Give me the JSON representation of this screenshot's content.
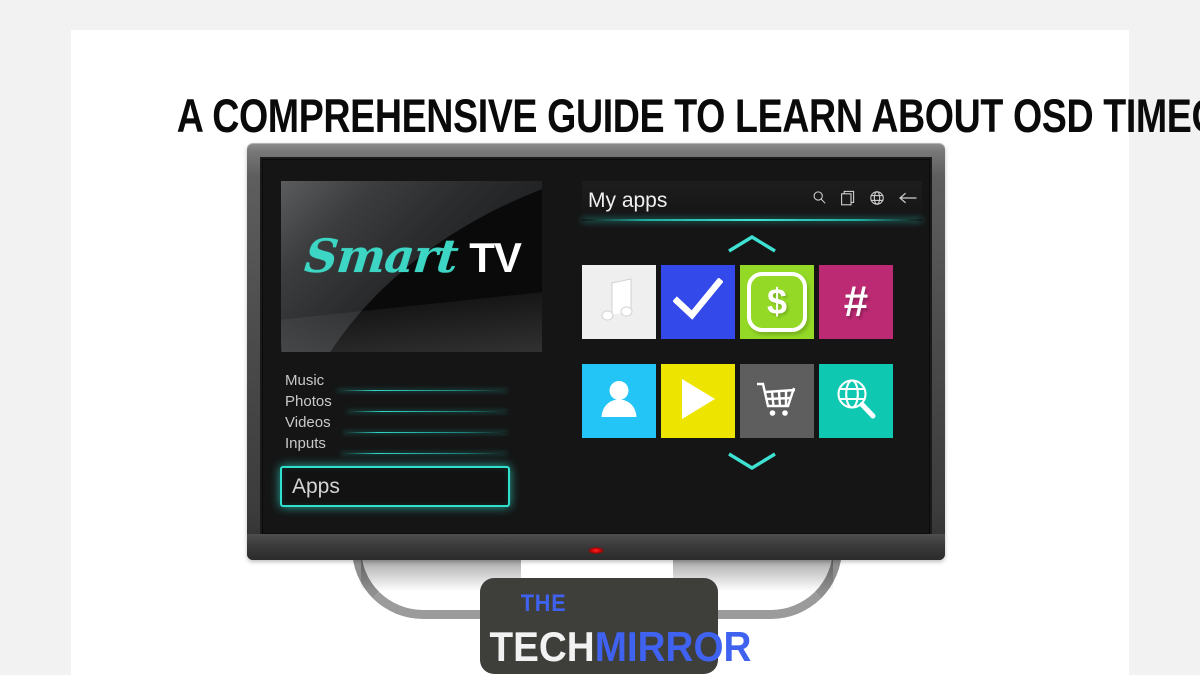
{
  "page": {
    "background_color": "#f2f2f2",
    "panel_color": "#ffffff",
    "title": "A COMPREHENSIVE GUIDE TO LEARN ABOUT OSD TIMEOUT"
  },
  "tv": {
    "brand_panel": {
      "script_word": "Smart",
      "block_word": "TV",
      "script_color": "#3dd6c4",
      "block_color": "#ffffff"
    },
    "led_color": "#ff2b2b",
    "bezel_color": "#4a4a4a",
    "screen_color": "#151515",
    "accent_color": "#2fe0cd",
    "menu": {
      "items": [
        {
          "label": "Music"
        },
        {
          "label": "Photos"
        },
        {
          "label": "Videos"
        },
        {
          "label": "Inputs"
        }
      ],
      "selected": {
        "label": "Apps"
      }
    },
    "apps_panel": {
      "title": "My apps",
      "header_icons": [
        {
          "name": "search-icon"
        },
        {
          "name": "windows-copy-icon"
        },
        {
          "name": "globe-icon"
        },
        {
          "name": "back-arrow-icon"
        }
      ],
      "scroll_up": {
        "name": "chevron-up-icon"
      },
      "scroll_down": {
        "name": "chevron-down-icon"
      },
      "tiles_row1": [
        {
          "name": "music-note-app",
          "icon": "music-note-icon",
          "bg": "#efefef",
          "fg": "#ffffff"
        },
        {
          "name": "checkmark-app",
          "icon": "checkmark-icon",
          "bg": "#3449e9",
          "fg": "#ffffff"
        },
        {
          "name": "money-app",
          "icon": "dollar-icon",
          "bg": "#93d926",
          "fg": "#ffffff",
          "glyph": "$"
        },
        {
          "name": "hashtag-app",
          "icon": "hash-icon",
          "bg": "#bc2a74",
          "fg": "#ffffff",
          "glyph": "#"
        }
      ],
      "tiles_row2": [
        {
          "name": "profile-app",
          "icon": "person-icon",
          "bg": "#22c5f5",
          "fg": "#ffffff"
        },
        {
          "name": "video-app",
          "icon": "play-icon",
          "bg": "#ede400",
          "fg": "#ffffff"
        },
        {
          "name": "store-app",
          "icon": "shopping-cart-icon",
          "bg": "#5e5e5e",
          "fg": "#ffffff"
        },
        {
          "name": "browser-search-app",
          "icon": "globe-magnifier-icon",
          "bg": "#0fc8b2",
          "fg": "#ffffff"
        }
      ]
    }
  },
  "site_logo": {
    "line1": "THE",
    "line2_part1": "TECH",
    "line2_part2": "MIRROR",
    "bg_color": "#3e3e3a",
    "accent_color": "#3f62f0",
    "light_color": "#f2f2f2"
  }
}
